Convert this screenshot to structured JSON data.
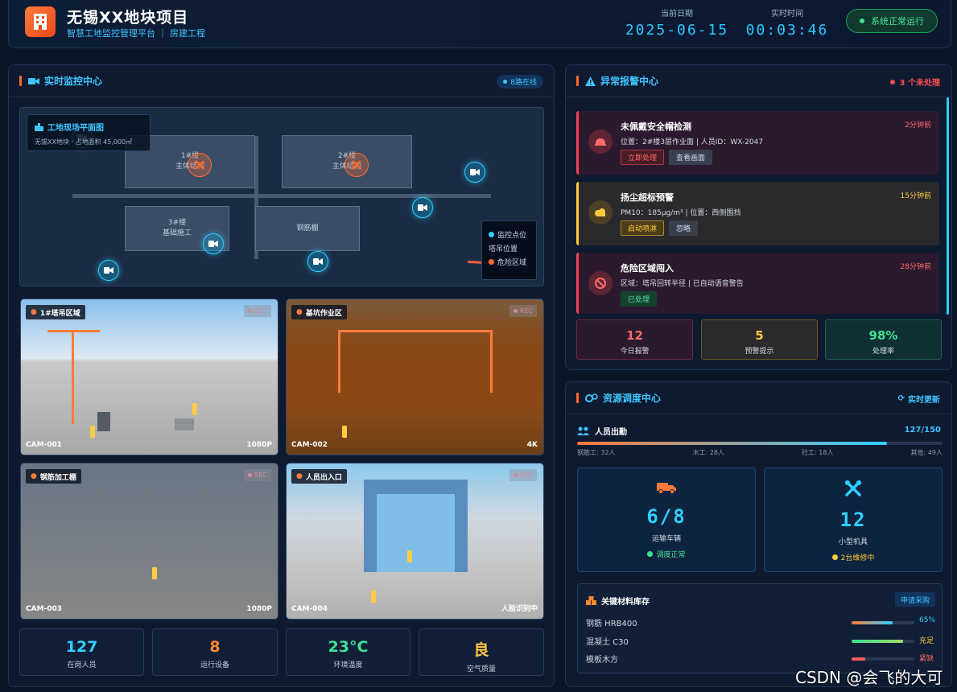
{
  "header": {
    "title": "无锡XX地块项目",
    "subtitle": "智慧工地监控管理平台 ｜ 房建工程",
    "date_label": "当前日期",
    "date": "2025-06-15",
    "time_label": "实时时间",
    "time": "00:03:46",
    "status": "系统正常运行"
  },
  "monitor": {
    "title": "实时监控中心",
    "badge": "8路在线",
    "map": {
      "title": "工地现场平面图",
      "info": "无锡XX地块 · 占地面积 45,000㎡",
      "buildings": {
        "b1": [
          "1#楼",
          "主体结构"
        ],
        "b2": [
          "2#楼",
          "主体结构"
        ],
        "b3": [
          "3#楼",
          "基础施工"
        ],
        "b4": "钢筋棚"
      },
      "legend": [
        "监控点位",
        "塔吊位置",
        "危险区域"
      ]
    },
    "cameras": [
      {
        "area": "1#塔吊区域",
        "id": "CAM-001",
        "res": "1080P",
        "rec": "REC"
      },
      {
        "area": "基坑作业区",
        "id": "CAM-002",
        "res": "4K",
        "rec": "REC"
      },
      {
        "area": "钢筋加工棚",
        "id": "CAM-003",
        "res": "1080P",
        "rec": "REC"
      },
      {
        "area": "人员出入口",
        "id": "CAM-004",
        "res": "人脸识别中",
        "rec": "REC"
      }
    ],
    "stats": [
      {
        "value": "127",
        "label": "在岗人员",
        "color": "#2fcfff"
      },
      {
        "value": "8",
        "label": "运行设备",
        "color": "#ff8a2d"
      },
      {
        "value": "23°C",
        "label": "环境温度",
        "color": "#3ee08f"
      },
      {
        "value": "良",
        "label": "空气质量",
        "color": "#ffc93c"
      }
    ]
  },
  "alerts": {
    "title": "异常报警中心",
    "pending": "3 个未处理",
    "items": [
      {
        "title": "未佩戴安全帽检测",
        "time": "2分钟前",
        "desc": "位置：2#楼3层作业面 | 人员ID：WX-2047",
        "btn1": "立即处理",
        "btn2": "查看画面"
      },
      {
        "title": "扬尘超标预警",
        "time": "15分钟前",
        "desc": "PM10：185μg/m³ | 位置：西侧围挡",
        "btn1": "启动喷淋",
        "btn2": "忽略"
      },
      {
        "title": "危险区域闯入",
        "time": "28分钟前",
        "desc": "区域：塔吊回转半径 | 已自动语音警告",
        "btn1": "已处理"
      }
    ],
    "summary": [
      {
        "value": "12",
        "label": "今日报警"
      },
      {
        "value": "5",
        "label": "预警提示"
      },
      {
        "value": "98%",
        "label": "处理率"
      }
    ]
  },
  "resources": {
    "title": "资源调度中心",
    "refresh": "实时更新",
    "attendance": {
      "label": "人员出勤",
      "value": "127/150",
      "fraction": 0.847,
      "breakdown": [
        "钢筋工: 32人",
        "木工: 28人",
        "砼工: 18人",
        "其他: 49人"
      ]
    },
    "vehicles": {
      "value": "6/8",
      "label": "运输车辆",
      "status": "调度正常"
    },
    "tools": {
      "value": "12",
      "label": "小型机具",
      "status": "2台维修中"
    },
    "materials": {
      "title": "关键材料库存",
      "button": "申请采购",
      "items": [
        {
          "name": "钢筋 HRB400",
          "value": "65%",
          "level": 0.65,
          "color": "#2fcfff"
        },
        {
          "name": "混凝土 C30",
          "value": "充足",
          "level": 0.82,
          "color": "#ffc93c"
        },
        {
          "name": "模板木方",
          "value": "紧缺",
          "level": 0.22,
          "color": "#ff5a5a"
        }
      ]
    }
  },
  "watermark": "CSDN @会飞的大可"
}
